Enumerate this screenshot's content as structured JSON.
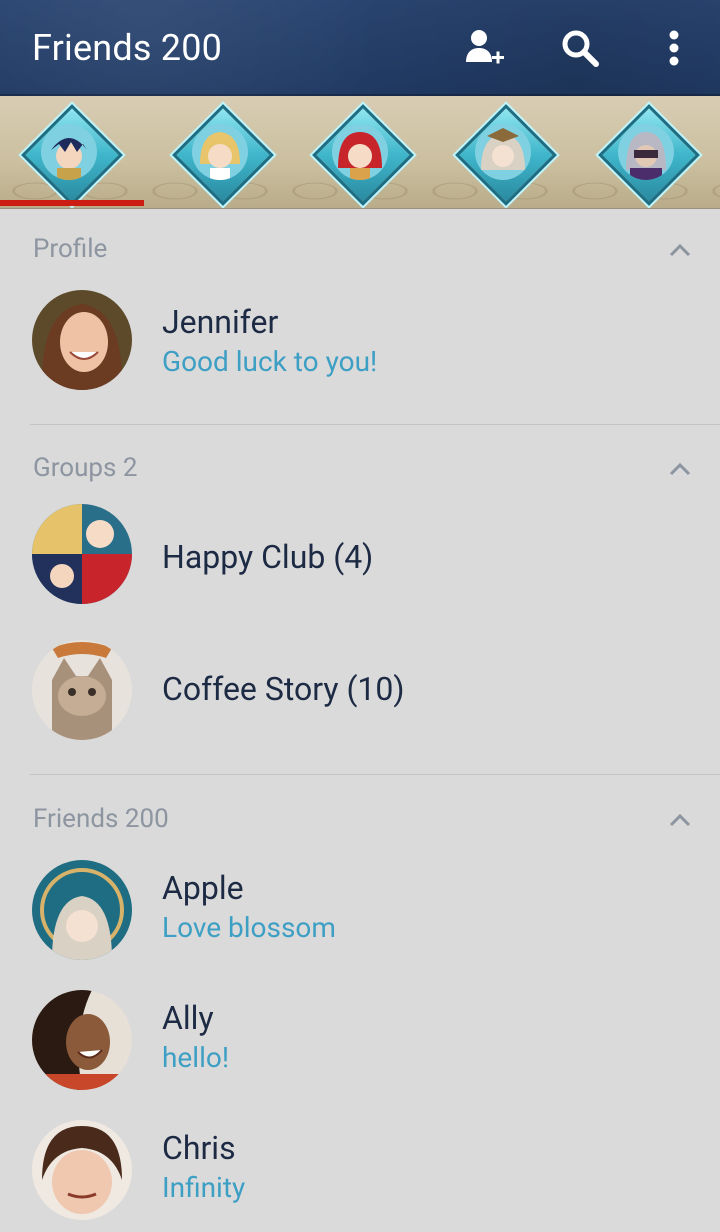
{
  "appbar": {
    "title": "Friends 200",
    "actions": [
      {
        "icon": "add-friend-icon"
      },
      {
        "icon": "search-icon"
      },
      {
        "icon": "more-vert-icon"
      }
    ]
  },
  "tabs": {
    "items": [
      {
        "icon": "hero-portrait-blue-hair"
      },
      {
        "icon": "hero-portrait-blonde"
      },
      {
        "icon": "hero-portrait-red-hair"
      },
      {
        "icon": "hero-portrait-silver-hair"
      },
      {
        "icon": "hero-portrait-masked"
      }
    ],
    "active_index": 0
  },
  "profile": {
    "header": "Profile",
    "name": "Jennifer",
    "status": "Good luck to you!"
  },
  "groups": {
    "header": "Groups 2",
    "items": [
      {
        "name": "Happy Club (4)"
      },
      {
        "name": "Coffee Story (10)"
      }
    ]
  },
  "friends": {
    "header": "Friends 200",
    "items": [
      {
        "name": "Apple",
        "status": "Love blossom"
      },
      {
        "name": "Ally",
        "status": "hello!"
      },
      {
        "name": "Chris",
        "status": "Infinity"
      }
    ]
  },
  "colors": {
    "appbar": "#25406a",
    "status_text": "#3e9fc4",
    "name_text": "#1d2a44",
    "header_text": "#8d95a1",
    "tab_indicator": "#cc1d12",
    "background": "#dadada"
  }
}
